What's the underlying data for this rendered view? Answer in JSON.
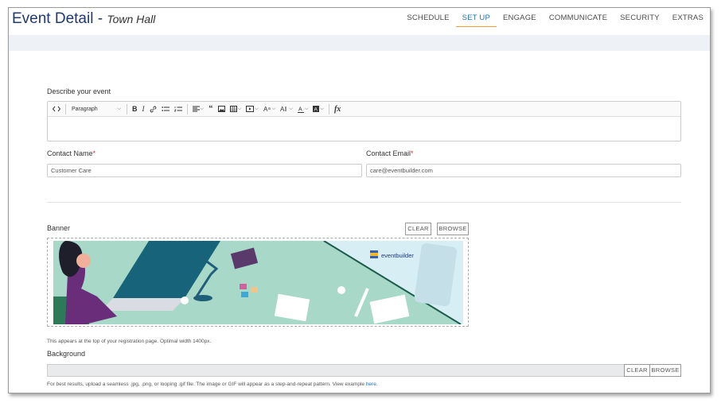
{
  "header": {
    "title": "Event Detail -",
    "subtitle": "Town Hall",
    "nav": [
      "SCHEDULE",
      "SET UP",
      "ENGAGE",
      "COMMUNICATE",
      "SECURITY",
      "EXTRAS"
    ],
    "active_tab": "SET UP",
    "accent_color": "#2370b8",
    "active_underline_color": "#f0a030"
  },
  "describe": {
    "label": "Describe your event",
    "paragraph_select": "Paragraph",
    "toolbar_icons": [
      "code-view-icon",
      "paragraph-format-select",
      "bold-icon",
      "italic-icon",
      "link-icon",
      "bullet-list-icon",
      "numbered-list-icon",
      "align-icon",
      "quote-icon",
      "image-icon",
      "table-icon",
      "video-icon",
      "font-size-icon",
      "text-style-icon",
      "font-color-icon",
      "background-color-icon",
      "formula-icon"
    ]
  },
  "contact_name": {
    "label": "Contact Name",
    "required_mark": "*",
    "value": "Customer Care"
  },
  "contact_email": {
    "label": "Contact Email",
    "required_mark": "*",
    "value": "care@eventbuilder.com"
  },
  "banner": {
    "label": "Banner",
    "clear_label": "CLEAR",
    "browse_label": "BROWSE",
    "brand_text": "eventbuilder",
    "hint": "This appears at the top of your registration page. Optimal width 1400px."
  },
  "background": {
    "label": "Background",
    "clear_label": "CLEAR",
    "browse_label": "BROWSE",
    "hint_text": "For best results, upload a seamless .jpg, .png, or looping .gif file. The image or GIF will appear as a step-and-repeat pattern. View example",
    "hint_link": "here",
    "hint_end": "."
  }
}
